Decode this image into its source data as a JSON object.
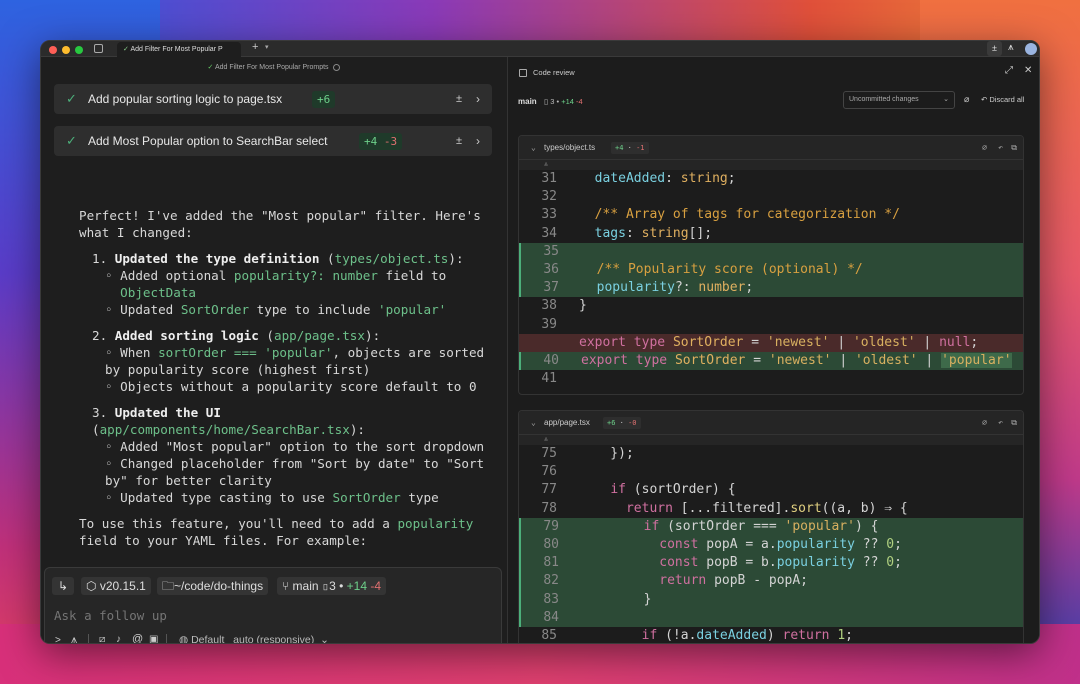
{
  "window": {
    "tab_title": "Add Filter For Most Popular P",
    "header_task": "Add Filter For Most Popular Prompts"
  },
  "cards": [
    {
      "label": "Add popular sorting logic to page.tsx",
      "added": "+6",
      "removed": ""
    },
    {
      "label": "Add Most Popular option to SearchBar select",
      "added": "+4",
      "removed": "-3"
    }
  ],
  "message": {
    "intro": "Perfect! I've added the \"Most popular\" filter. Here's what I changed:",
    "s1_title": "Updated the type definition",
    "s1_file": "types/object.ts",
    "s1_b1_pre": "Added optional ",
    "s1_b1_code": "popularity?: number",
    "s1_b1_mid": " field to ",
    "s1_b1_code2": "ObjectData",
    "s1_b2_pre": "Updated ",
    "s1_b2_code": "SortOrder",
    "s1_b2_mid": " type to include ",
    "s1_b2_code2": "'popular'",
    "s2_title": "Added sorting logic",
    "s2_file": "app/page.tsx",
    "s2_b1_pre": "When ",
    "s2_b1_code": "sortOrder === 'popular'",
    "s2_b1_post": ", objects are sorted by popularity score (highest first)",
    "s2_b2": "Objects without a popularity score default to 0",
    "s3_title": "Updated the UI",
    "s3_file": "app/components/home/SearchBar.tsx",
    "s3_b1": "Added \"Most popular\" option to the sort dropdown",
    "s3_b2": "Changed placeholder from \"Sort by date\" to \"Sort by\" for better clarity",
    "s3_b3_pre": "Updated type casting to use ",
    "s3_b3_code": "SortOrder",
    "s3_b3_post": " type",
    "outro_pre": "To use this feature, you'll need to add a ",
    "outro_code": "popularity",
    "outro_post": " field to your YAML files. For example:"
  },
  "input": {
    "node_version": "v20.15.1",
    "path": "~/code/do-things",
    "branch": "main",
    "files": "3",
    "added": "+14",
    "removed": "-4",
    "placeholder": "Ask a follow up",
    "mode": "Default",
    "model": "auto (responsive)"
  },
  "review": {
    "title": "Code review",
    "branch": "main",
    "files": "3",
    "added": "+14",
    "removed": "-4",
    "select": "Uncommitted changes",
    "discard": "Discard all"
  },
  "files": [
    {
      "name": "types/object.ts",
      "added": "+4",
      "removed": "-1"
    },
    {
      "name": "app/page.tsx",
      "added": "+6",
      "removed": "-0"
    }
  ],
  "colors": {
    "accent_green": "#4caf7a",
    "add_bg": "#2c4a36",
    "del_bg": "#4a2a2a"
  }
}
